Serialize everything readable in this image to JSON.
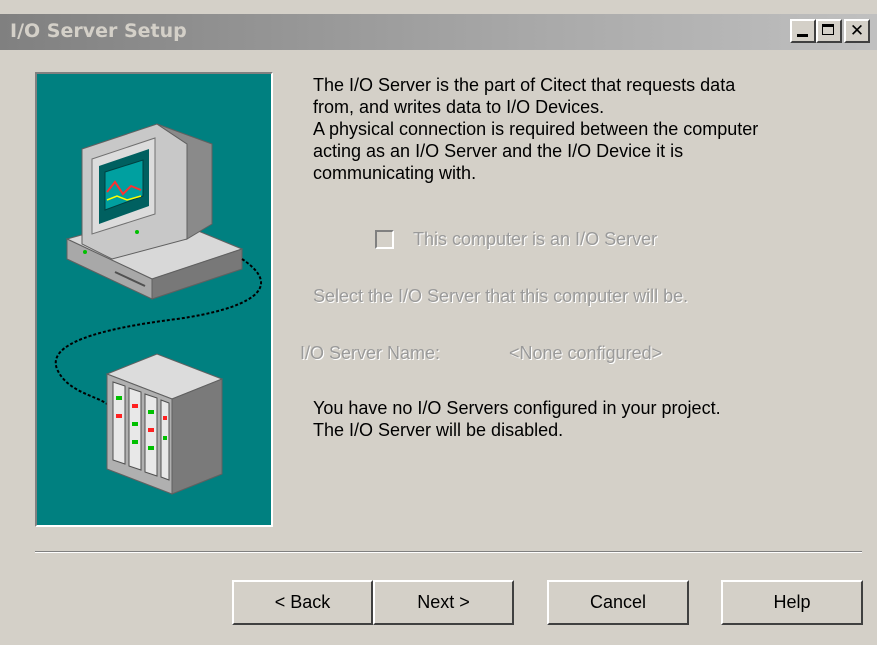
{
  "window": {
    "title": "I/O Server Setup",
    "controls": {
      "minimize_icon": "minimize-icon",
      "maximize_icon": "maximize-icon",
      "close_icon": "close-icon",
      "close_glyph": "✕"
    }
  },
  "illustration": {
    "icon": "computer-and-io-device-illustration",
    "background_color": "#008080"
  },
  "description": {
    "lines": [
      "The I/O Server is the part of Citect that requests data",
      "from, and writes data to I/O Devices.",
      "A physical connection is required between the computer",
      "acting as an I/O Server and the I/O Device it is",
      "communicating with."
    ]
  },
  "checkbox": {
    "label": "This computer is an I/O Server",
    "checked": false,
    "enabled": false
  },
  "select_text": "Select the I/O Server that this computer will be.",
  "io_server": {
    "label": "I/O Server Name:",
    "value": "<None configured>"
  },
  "note": {
    "lines": [
      "You have no I/O Servers configured in your project.",
      "The I/O Server will be disabled."
    ]
  },
  "buttons": {
    "back": "< Back",
    "next": "Next >",
    "cancel": "Cancel",
    "help": "Help"
  },
  "colors": {
    "face": "#d4d0c8",
    "disabled_text": "#9a9a9a",
    "title_text": "#d4d0c8"
  }
}
